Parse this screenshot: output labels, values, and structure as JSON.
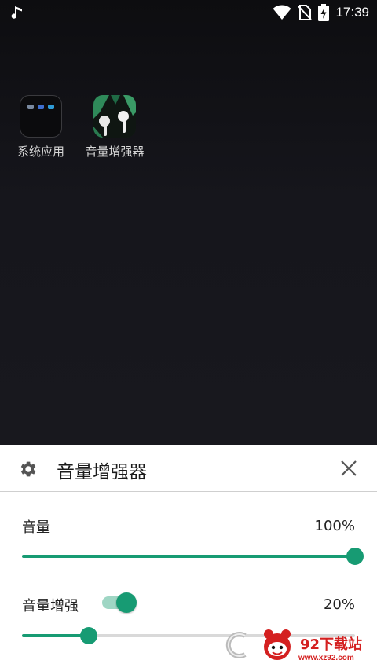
{
  "status_bar": {
    "time": "17:39",
    "icons": [
      "music-note-icon",
      "wifi-icon",
      "no-sim-icon",
      "battery-charging-icon"
    ]
  },
  "home_screen": {
    "apps": [
      {
        "label": "系统应用",
        "icon": "folder-icon"
      },
      {
        "label": "音量增强器",
        "icon": "earbuds-app-icon"
      }
    ]
  },
  "dialog": {
    "title": "音量增强器",
    "settings_icon": "gear-icon",
    "close_icon": "close-icon",
    "volume": {
      "label": "音量",
      "value_text": "100%",
      "level": 1.0
    },
    "boost": {
      "label": "音量增强",
      "value_text": "20%",
      "level": 0.2,
      "enabled": true
    }
  },
  "accent_color": "#179b73",
  "watermark": {
    "text": "92下载站",
    "url": "www.xz92.com"
  }
}
